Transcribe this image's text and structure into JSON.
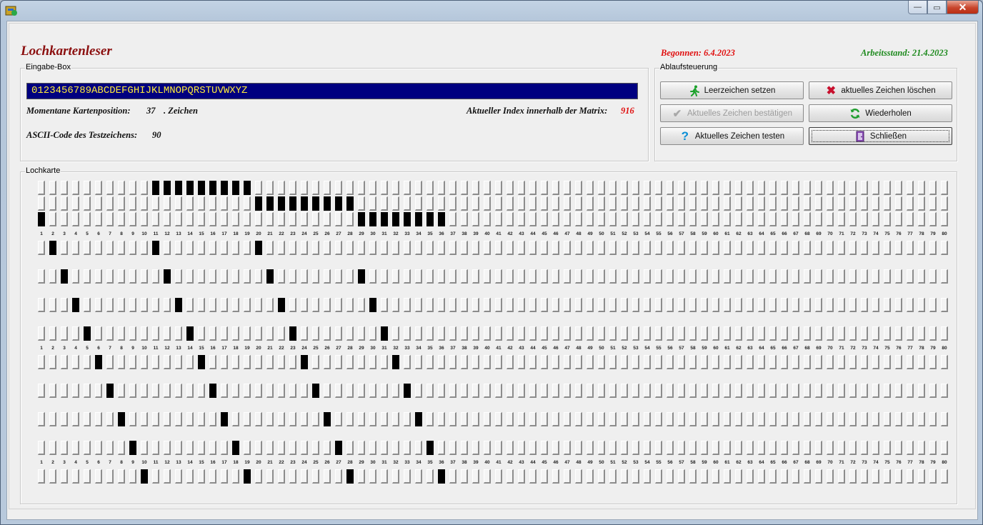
{
  "app": {
    "title": "Lochkartenleser",
    "begonnen": "Begonnen: 6.4.2023",
    "arbeitsstand": "Arbeitsstand: 21.4.2023"
  },
  "eingabe": {
    "legend": "Eingabe-Box",
    "value": "0123456789ABCDEFGHIJKLMNOPQRSTUVWXYZ",
    "kartenposition_label": "Momentane Kartenposition:",
    "kartenposition_value": "37",
    "kartenposition_suffix": ". Zeichen",
    "index_label": "Aktueller Index innerhalb der Matrix:",
    "index_value": "916",
    "ascii_label": "ASCII-Code des Testzeichens:",
    "ascii_value": "90"
  },
  "ablauf": {
    "legend": "Ablaufsteuerung",
    "btn_leerzeichen": "Leerzeichen setzen",
    "btn_loeschen": "aktuelles Zeichen löschen",
    "btn_bestaetigen": "Aktuelles Zeichen bestätigen",
    "btn_wiederholen": "Wiederholen",
    "btn_testen": "Aktuelles Zeichen testen",
    "btn_schliessen": "Schließen"
  },
  "lochkarte": {
    "legend": "Lochkarte",
    "columns": 80,
    "rows": 12,
    "punched": [
      [
        11,
        12,
        13,
        14,
        15,
        16,
        17,
        18,
        19
      ],
      [
        20,
        21,
        22,
        23,
        24,
        25,
        26,
        27,
        28
      ],
      [
        1,
        29,
        30,
        31,
        32,
        33,
        34,
        35,
        36
      ],
      [
        2,
        11,
        20
      ],
      [
        3,
        12,
        21,
        29
      ],
      [
        4,
        13,
        22,
        30
      ],
      [
        5,
        14,
        23,
        31
      ],
      [
        6,
        15,
        24,
        32
      ],
      [
        7,
        16,
        25,
        33
      ],
      [
        8,
        17,
        26,
        34
      ],
      [
        9,
        18,
        27,
        35
      ],
      [
        10,
        19,
        28,
        36
      ]
    ],
    "number_rows_after": [
      3,
      7,
      11
    ]
  },
  "icons": {
    "app": "punchcard-app-icon",
    "leerzeichen": "running-man-icon",
    "loeschen": "red-x-icon",
    "bestaetigen": "checkmark-icon",
    "wiederholen": "refresh-icon",
    "testen": "question-mark-icon",
    "schliessen": "exit-door-icon"
  },
  "colors": {
    "title": "#8b0f0f",
    "begonnen": "#e01010",
    "arbeitsstand": "#1e8a1e",
    "input_bg": "#000080",
    "input_text": "#ffeb3b"
  }
}
